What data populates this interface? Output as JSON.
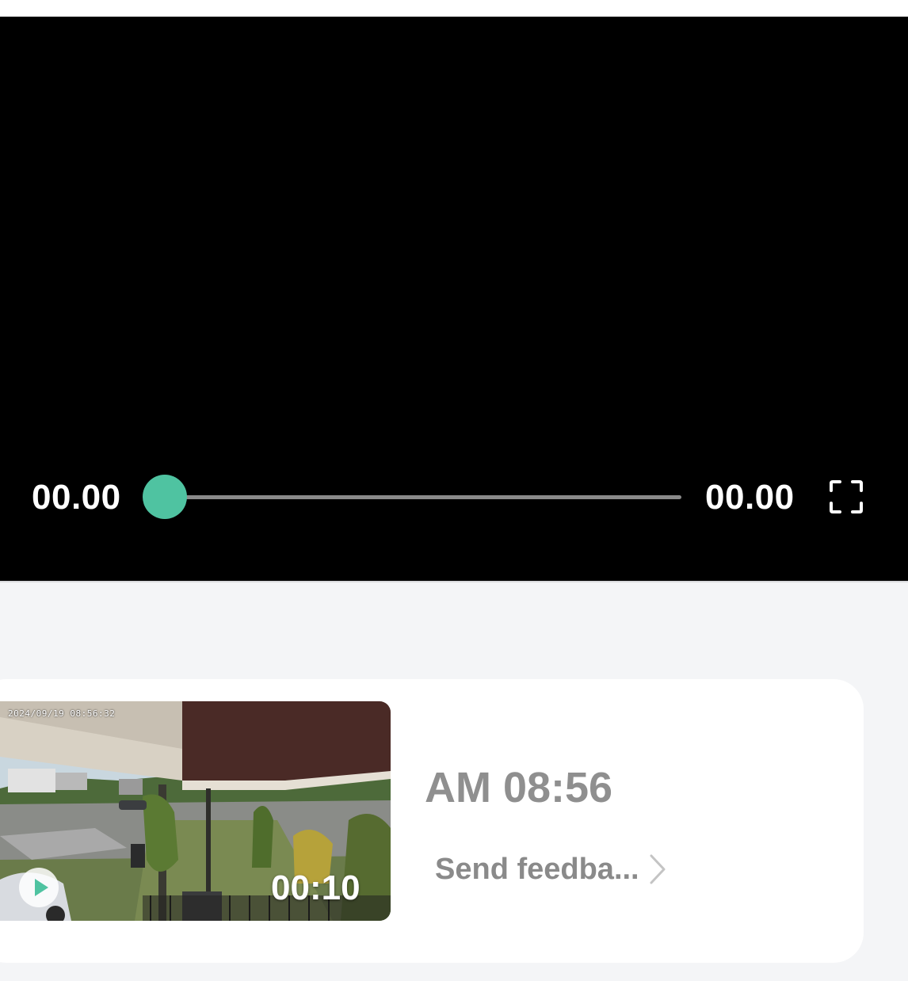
{
  "player": {
    "current_time": "00.00",
    "total_time": "00.00",
    "progress": 0,
    "accent_color": "#4fc3a1"
  },
  "recording": {
    "timestamp": "2024/09/19 08:56:32",
    "duration": "00:10",
    "time_label": "AM 08:56",
    "feedback_label": "Send feedba...",
    "icons": [
      "play-icon",
      "chevron-right-icon",
      "fullscreen-icon"
    ]
  }
}
